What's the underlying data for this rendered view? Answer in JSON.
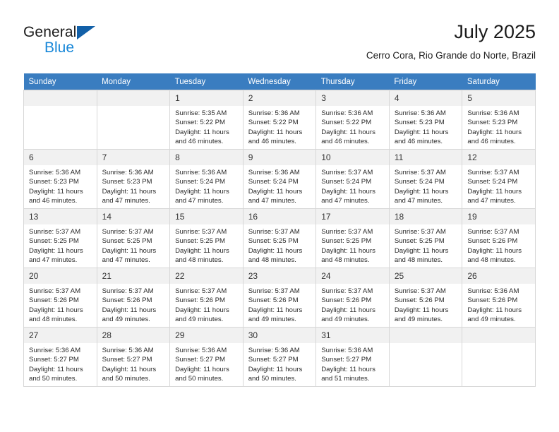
{
  "brand": {
    "name_top": "General",
    "name_bottom": "Blue",
    "triangle_color": "#1260a8",
    "blue_text_color": "#1787d8"
  },
  "header": {
    "title": "July 2025",
    "subtitle": "Cerro Cora, Rio Grande do Norte, Brazil"
  },
  "theme": {
    "header_row_bg": "#3a7dc0",
    "header_row_text": "#ffffff",
    "daynum_bg": "#f1f1f1",
    "cell_border": "#d7d7d7"
  },
  "weekdays": [
    "Sunday",
    "Monday",
    "Tuesday",
    "Wednesday",
    "Thursday",
    "Friday",
    "Saturday"
  ],
  "labels": {
    "sunrise_prefix": "Sunrise:",
    "sunset_prefix": "Sunset:",
    "daylight_prefix": "Daylight:"
  },
  "weeks": [
    [
      {
        "day": "",
        "sunrise": "",
        "sunset": "",
        "daylight": "",
        "empty": true
      },
      {
        "day": "",
        "sunrise": "",
        "sunset": "",
        "daylight": "",
        "empty": true
      },
      {
        "day": "1",
        "sunrise": "Sunrise: 5:35 AM",
        "sunset": "Sunset: 5:22 PM",
        "daylight": "Daylight: 11 hours and 46 minutes."
      },
      {
        "day": "2",
        "sunrise": "Sunrise: 5:36 AM",
        "sunset": "Sunset: 5:22 PM",
        "daylight": "Daylight: 11 hours and 46 minutes."
      },
      {
        "day": "3",
        "sunrise": "Sunrise: 5:36 AM",
        "sunset": "Sunset: 5:22 PM",
        "daylight": "Daylight: 11 hours and 46 minutes."
      },
      {
        "day": "4",
        "sunrise": "Sunrise: 5:36 AM",
        "sunset": "Sunset: 5:23 PM",
        "daylight": "Daylight: 11 hours and 46 minutes."
      },
      {
        "day": "5",
        "sunrise": "Sunrise: 5:36 AM",
        "sunset": "Sunset: 5:23 PM",
        "daylight": "Daylight: 11 hours and 46 minutes."
      }
    ],
    [
      {
        "day": "6",
        "sunrise": "Sunrise: 5:36 AM",
        "sunset": "Sunset: 5:23 PM",
        "daylight": "Daylight: 11 hours and 46 minutes."
      },
      {
        "day": "7",
        "sunrise": "Sunrise: 5:36 AM",
        "sunset": "Sunset: 5:23 PM",
        "daylight": "Daylight: 11 hours and 47 minutes."
      },
      {
        "day": "8",
        "sunrise": "Sunrise: 5:36 AM",
        "sunset": "Sunset: 5:24 PM",
        "daylight": "Daylight: 11 hours and 47 minutes."
      },
      {
        "day": "9",
        "sunrise": "Sunrise: 5:36 AM",
        "sunset": "Sunset: 5:24 PM",
        "daylight": "Daylight: 11 hours and 47 minutes."
      },
      {
        "day": "10",
        "sunrise": "Sunrise: 5:37 AM",
        "sunset": "Sunset: 5:24 PM",
        "daylight": "Daylight: 11 hours and 47 minutes."
      },
      {
        "day": "11",
        "sunrise": "Sunrise: 5:37 AM",
        "sunset": "Sunset: 5:24 PM",
        "daylight": "Daylight: 11 hours and 47 minutes."
      },
      {
        "day": "12",
        "sunrise": "Sunrise: 5:37 AM",
        "sunset": "Sunset: 5:24 PM",
        "daylight": "Daylight: 11 hours and 47 minutes."
      }
    ],
    [
      {
        "day": "13",
        "sunrise": "Sunrise: 5:37 AM",
        "sunset": "Sunset: 5:25 PM",
        "daylight": "Daylight: 11 hours and 47 minutes."
      },
      {
        "day": "14",
        "sunrise": "Sunrise: 5:37 AM",
        "sunset": "Sunset: 5:25 PM",
        "daylight": "Daylight: 11 hours and 47 minutes."
      },
      {
        "day": "15",
        "sunrise": "Sunrise: 5:37 AM",
        "sunset": "Sunset: 5:25 PM",
        "daylight": "Daylight: 11 hours and 48 minutes."
      },
      {
        "day": "16",
        "sunrise": "Sunrise: 5:37 AM",
        "sunset": "Sunset: 5:25 PM",
        "daylight": "Daylight: 11 hours and 48 minutes."
      },
      {
        "day": "17",
        "sunrise": "Sunrise: 5:37 AM",
        "sunset": "Sunset: 5:25 PM",
        "daylight": "Daylight: 11 hours and 48 minutes."
      },
      {
        "day": "18",
        "sunrise": "Sunrise: 5:37 AM",
        "sunset": "Sunset: 5:25 PM",
        "daylight": "Daylight: 11 hours and 48 minutes."
      },
      {
        "day": "19",
        "sunrise": "Sunrise: 5:37 AM",
        "sunset": "Sunset: 5:26 PM",
        "daylight": "Daylight: 11 hours and 48 minutes."
      }
    ],
    [
      {
        "day": "20",
        "sunrise": "Sunrise: 5:37 AM",
        "sunset": "Sunset: 5:26 PM",
        "daylight": "Daylight: 11 hours and 48 minutes."
      },
      {
        "day": "21",
        "sunrise": "Sunrise: 5:37 AM",
        "sunset": "Sunset: 5:26 PM",
        "daylight": "Daylight: 11 hours and 49 minutes."
      },
      {
        "day": "22",
        "sunrise": "Sunrise: 5:37 AM",
        "sunset": "Sunset: 5:26 PM",
        "daylight": "Daylight: 11 hours and 49 minutes."
      },
      {
        "day": "23",
        "sunrise": "Sunrise: 5:37 AM",
        "sunset": "Sunset: 5:26 PM",
        "daylight": "Daylight: 11 hours and 49 minutes."
      },
      {
        "day": "24",
        "sunrise": "Sunrise: 5:37 AM",
        "sunset": "Sunset: 5:26 PM",
        "daylight": "Daylight: 11 hours and 49 minutes."
      },
      {
        "day": "25",
        "sunrise": "Sunrise: 5:37 AM",
        "sunset": "Sunset: 5:26 PM",
        "daylight": "Daylight: 11 hours and 49 minutes."
      },
      {
        "day": "26",
        "sunrise": "Sunrise: 5:36 AM",
        "sunset": "Sunset: 5:26 PM",
        "daylight": "Daylight: 11 hours and 49 minutes."
      }
    ],
    [
      {
        "day": "27",
        "sunrise": "Sunrise: 5:36 AM",
        "sunset": "Sunset: 5:27 PM",
        "daylight": "Daylight: 11 hours and 50 minutes."
      },
      {
        "day": "28",
        "sunrise": "Sunrise: 5:36 AM",
        "sunset": "Sunset: 5:27 PM",
        "daylight": "Daylight: 11 hours and 50 minutes."
      },
      {
        "day": "29",
        "sunrise": "Sunrise: 5:36 AM",
        "sunset": "Sunset: 5:27 PM",
        "daylight": "Daylight: 11 hours and 50 minutes."
      },
      {
        "day": "30",
        "sunrise": "Sunrise: 5:36 AM",
        "sunset": "Sunset: 5:27 PM",
        "daylight": "Daylight: 11 hours and 50 minutes."
      },
      {
        "day": "31",
        "sunrise": "Sunrise: 5:36 AM",
        "sunset": "Sunset: 5:27 PM",
        "daylight": "Daylight: 11 hours and 51 minutes."
      },
      {
        "day": "",
        "sunrise": "",
        "sunset": "",
        "daylight": "",
        "empty": true
      },
      {
        "day": "",
        "sunrise": "",
        "sunset": "",
        "daylight": "",
        "empty": true
      }
    ]
  ]
}
